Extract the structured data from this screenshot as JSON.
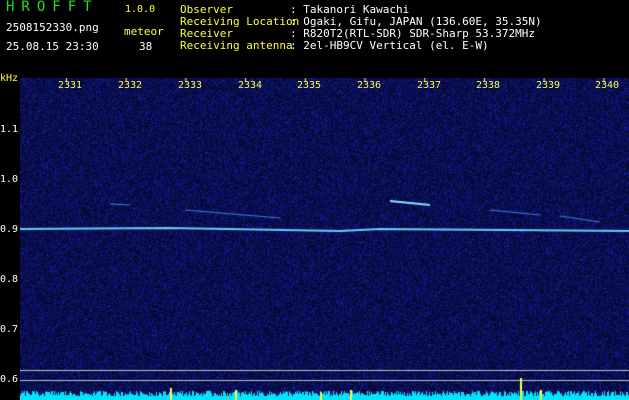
{
  "app": {
    "title": "HROFFT",
    "version": "1.0.0"
  },
  "file": {
    "name": "2508152330.png",
    "datetime": "25.08.15 23:30"
  },
  "meteor": {
    "label": "meteor",
    "count": "38"
  },
  "info": [
    {
      "key": "Observer",
      "value": ": Takanori Kawachi"
    },
    {
      "key": "Receiving Location",
      "value": ": Ogaki, Gifu, JAPAN (136.60E, 35.35N)"
    },
    {
      "key": "Receiver",
      "value": ": R820T2(RTL-SDR) SDR-Sharp 53.372MHz"
    },
    {
      "key": "Receiving antenna",
      "value": ": 2el-HB9CV Vertical (el. E-W)"
    }
  ],
  "axes": {
    "y_unit": "kHz",
    "y_ticks": [
      "1.1",
      "1.0",
      "0.9",
      "0.8",
      "0.7",
      "0.6"
    ],
    "x_ticks": [
      "2331",
      "2332",
      "2333",
      "2334",
      "2335",
      "2336",
      "2337",
      "2338",
      "2339",
      "2340"
    ]
  },
  "colors": {
    "background": "#000000",
    "noise": "#1a2aa0",
    "carrier": "#66ccff",
    "level_bar": "#00e5ff",
    "level_peak": "#ffff44",
    "label_green": "#22dd22",
    "label_yellow": "#ffff44"
  }
}
